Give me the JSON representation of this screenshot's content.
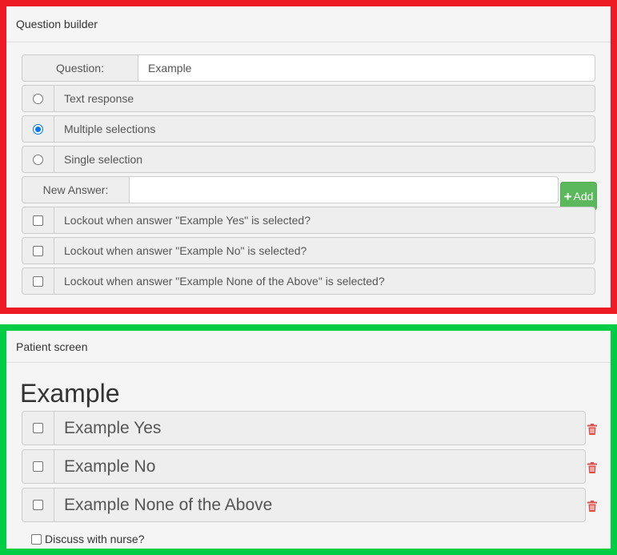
{
  "builder": {
    "title": "Question builder",
    "question_label": "Question:",
    "question_value": "Example",
    "response_types": [
      {
        "label": "Text response",
        "selected": false
      },
      {
        "label": "Multiple selections",
        "selected": true
      },
      {
        "label": "Single selection",
        "selected": false
      }
    ],
    "new_answer_label": "New Answer:",
    "new_answer_value": "",
    "add_label": "Add",
    "lockouts": [
      {
        "label": "Lockout when answer \"Example Yes\" is selected?",
        "checked": false
      },
      {
        "label": "Lockout when answer \"Example No\" is selected?",
        "checked": false
      },
      {
        "label": "Lockout when answer \"Example None of the Above\" is selected?",
        "checked": false
      }
    ]
  },
  "patient": {
    "title": "Patient screen",
    "question": "Example",
    "answers": [
      {
        "label": "Example Yes",
        "checked": false
      },
      {
        "label": "Example No",
        "checked": false
      },
      {
        "label": "Example None of the Above",
        "checked": false
      }
    ],
    "discuss_label": "Discuss with nurse?"
  },
  "colors": {
    "builder_frame": "#ed1c24",
    "patient_frame": "#00cc44",
    "add_button": "#5cb85c",
    "radio_selected": "#0075ff",
    "trash": "#d9534f"
  }
}
